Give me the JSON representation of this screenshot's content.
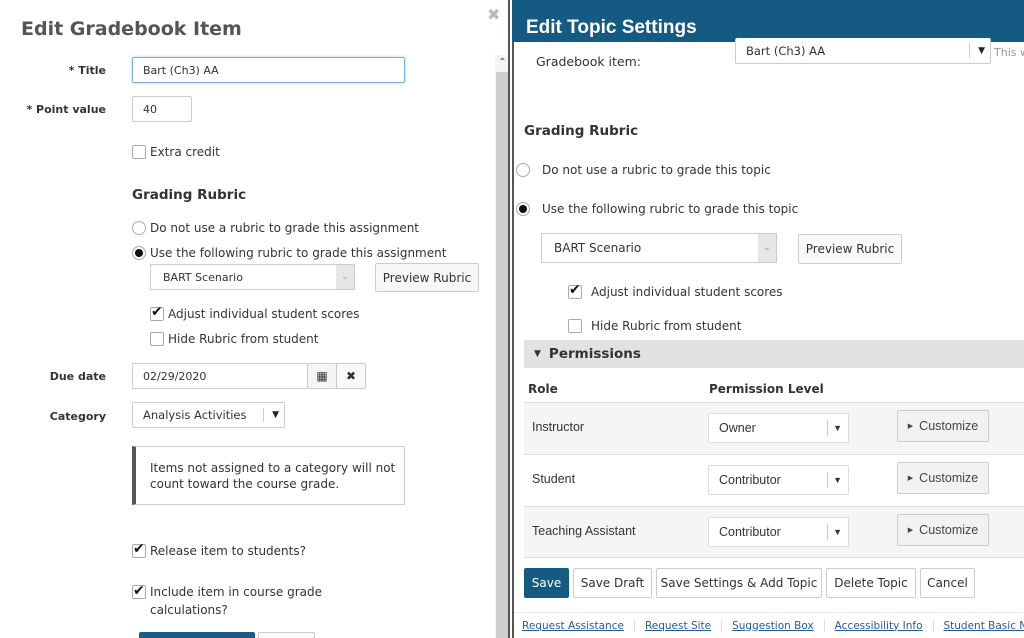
{
  "left_dialog": {
    "title": "Edit Gradebook Item",
    "close_icon": "close-icon",
    "title_label": "* Title",
    "title_value": "Bart (Ch3) AA",
    "point_label": "* Point value",
    "point_value": "40",
    "extra_credit_label": "Extra credit",
    "extra_credit_checked": false,
    "rubric_heading": "Grading Rubric",
    "rubric_option_none": "Do not use a rubric to grade this assignment",
    "rubric_option_use": "Use the following rubric to grade this assignment",
    "rubric_selected": "BART Scenario",
    "preview_rubric": "Preview Rubric",
    "adjust_scores_label": "Adjust individual student scores",
    "adjust_scores_checked": true,
    "hide_rubric_label": "Hide Rubric from student",
    "hide_rubric_checked": false,
    "due_date_label": "Due date",
    "due_date_value": "02/29/2020",
    "category_label": "Category",
    "category_value": "Analysis Activities",
    "category_note": "Items not assigned to a category will not count toward the course grade.",
    "release_label": "Release item to students?",
    "release_checked": true,
    "include_label": "Include item in course grade calculations?",
    "include_checked": true
  },
  "right_dialog": {
    "title": "Edit Topic Settings",
    "gradebook_item_label": "Gradebook item:",
    "gradebook_item_value": "Bart (Ch3) AA",
    "gradebook_item_hint": "This w",
    "rubric_heading": "Grading Rubric",
    "rubric_option_none": "Do not use a rubric to grade this topic",
    "rubric_option_use": "Use the following rubric to grade this topic",
    "rubric_selected": "BART Scenario",
    "preview_rubric": "Preview Rubric",
    "adjust_scores_label": "Adjust individual student scores",
    "adjust_scores_checked": true,
    "hide_rubric_label": "Hide Rubric from student",
    "hide_rubric_checked": false,
    "permissions_heading": "Permissions",
    "columns": {
      "role": "Role",
      "level": "Permission Level"
    },
    "permissions": [
      {
        "role": "Instructor",
        "level": "Owner",
        "customize": "Customize"
      },
      {
        "role": "Student",
        "level": "Contributor",
        "customize": "Customize"
      },
      {
        "role": "Teaching Assistant",
        "level": "Contributor",
        "customize": "Customize"
      }
    ],
    "actions": {
      "save": "Save",
      "save_draft": "Save Draft",
      "save_add": "Save Settings & Add Topic",
      "delete": "Delete Topic",
      "cancel": "Cancel"
    },
    "footer_links": [
      "Request Assistance",
      "Request Site",
      "Suggestion Box",
      "Accessibility Info",
      "Student Basic Needs"
    ],
    "colors": {
      "header": "#155a82",
      "primary_button": "#155a82",
      "link": "#235f8e"
    }
  }
}
